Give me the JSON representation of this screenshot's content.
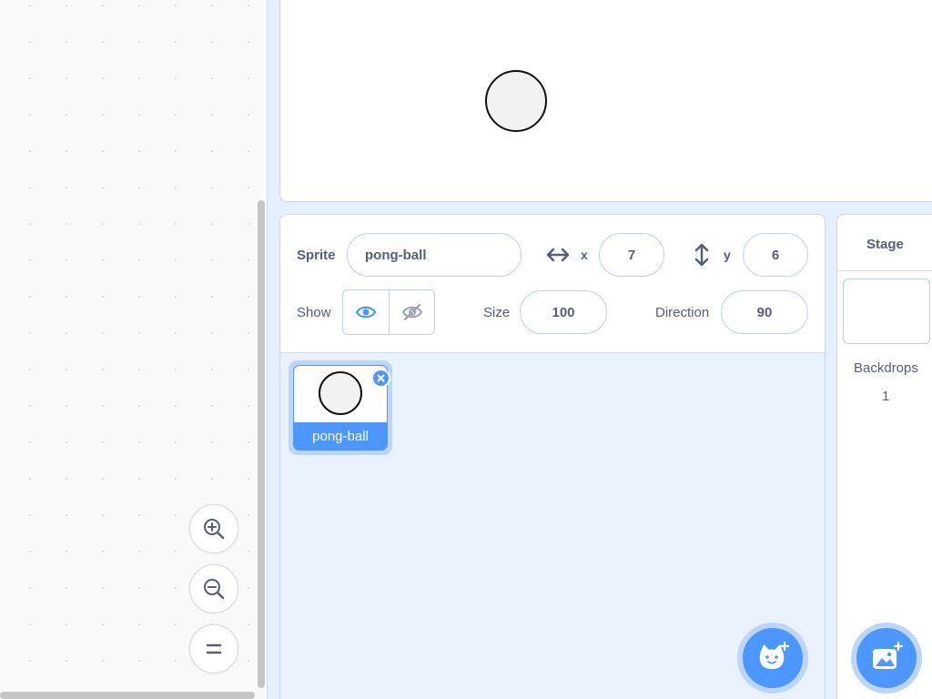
{
  "workspace": {
    "zoom_in_icon": "zoom-in-icon",
    "zoom_out_icon": "zoom-out-icon",
    "reset_zoom_icon": "reset-zoom-icon"
  },
  "sprite_info": {
    "sprite_label": "Sprite",
    "sprite_name": "pong-ball",
    "x_label": "x",
    "x_value": "7",
    "y_label": "y",
    "y_value": "6",
    "show_label": "Show",
    "size_label": "Size",
    "size_value": "100",
    "direction_label": "Direction",
    "direction_value": "90"
  },
  "sprites": [
    {
      "name": "pong-ball",
      "selected": true
    }
  ],
  "stage_selector": {
    "title": "Stage",
    "backdrops_label": "Backdrops",
    "backdrops_count": "1"
  },
  "colors": {
    "accent": "#4c97ff",
    "accent_light": "#bcd5f9",
    "text": "#575e75",
    "pane_bg": "#e9f1fc"
  }
}
